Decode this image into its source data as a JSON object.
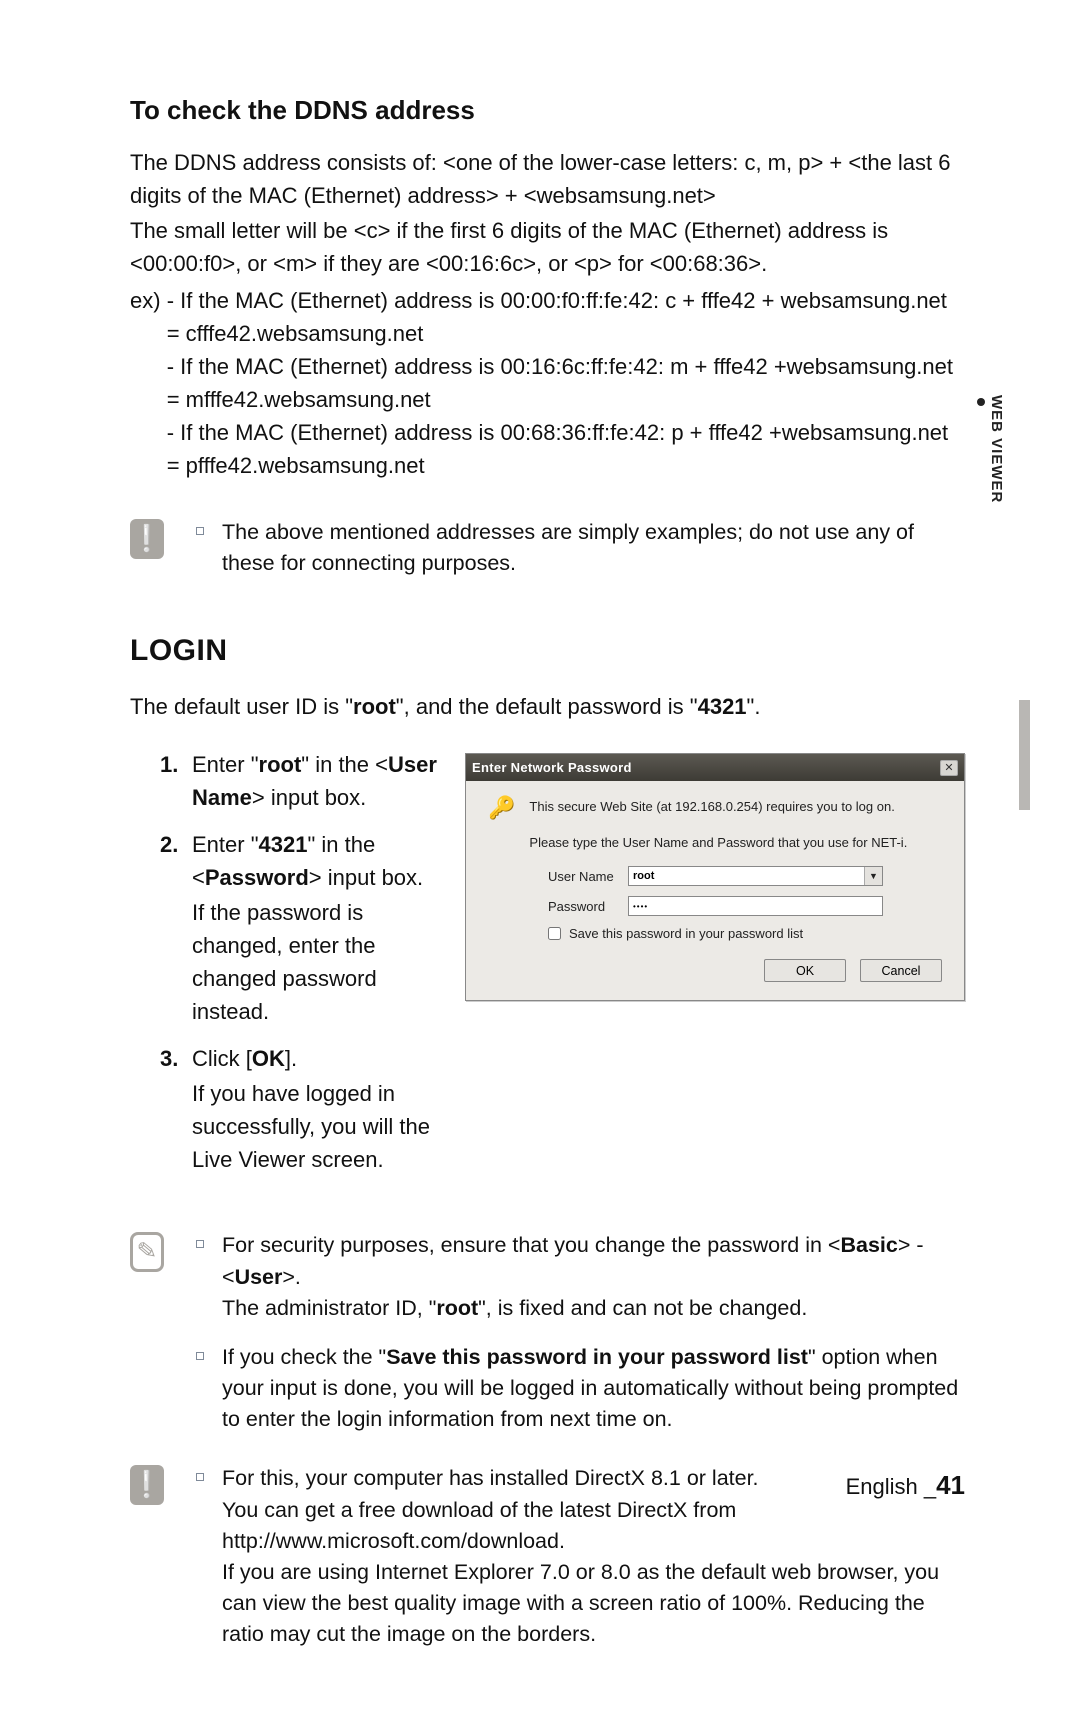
{
  "side_tab": "WEB VIEWER",
  "ddns": {
    "title": "To check the DDNS address",
    "p1": "The DDNS address consists of: <one of the lower-case letters: c, m, p> + <the last 6 digits of the MAC (Ethernet) address> + <websamsung.net>",
    "p2": "The small letter will be <c> if the first 6 digits of the MAC (Ethernet) address is <00:00:f0>, or <m> if they are <00:16:6c>, or <p> for <00:68:36>.",
    "ex_prefix": "ex) ",
    "ex1": "- If the MAC (Ethernet) address is 00:00:f0:ff:fe:42: c + fffe42 + websamsung.net = cfffe42.websamsung.net",
    "ex2": "- If the MAC (Ethernet) address is 00:16:6c:ff:fe:42: m + fffe42 +websamsung.net = mfffe42.websamsung.net",
    "ex3": "- If the MAC (Ethernet) address is 00:68:36:ff:fe:42: p + fffe42 +websamsung.net = pfffe42.websamsung.net",
    "note": "The above mentioned addresses are simply examples; do not use any of these for connecting purposes."
  },
  "login": {
    "title": "LOGIN",
    "intro_pre": "The default user ID is \"",
    "intro_root": "root",
    "intro_mid": "\", and the default password is \"",
    "intro_pass": "4321",
    "intro_post": "\".",
    "steps": {
      "s1_num": "1.",
      "s1_a": "Enter \"",
      "s1_b": "root",
      "s1_c": "\" in the <",
      "s1_d": "User Name",
      "s1_e": "> input box.",
      "s2_num": "2.",
      "s2_a": "Enter \"",
      "s2_b": "4321",
      "s2_c": "\" in the <",
      "s2_d": "Password",
      "s2_e": "> input box.",
      "s2_sub": "If the password is changed, enter the changed password instead.",
      "s3_num": "3.",
      "s3_a": "Click [",
      "s3_b": "OK",
      "s3_c": "].",
      "s3_sub": "If you have logged in successfully, you will the Live Viewer screen."
    },
    "notes1": {
      "n1_a": "For security purposes, ensure that you change the password in <",
      "n1_b": "Basic",
      "n1_c": "> - <",
      "n1_d": "User",
      "n1_e": ">.",
      "n1_line2_a": "The administrator ID, \"",
      "n1_line2_b": "root",
      "n1_line2_c": "\", is fixed and can not be changed.",
      "n2_a": "If you check the \"",
      "n2_b": "Save this password in your password list",
      "n2_c": "\" option when your input is done, you will be logged in automatically without being prompted to enter the login information from next time on."
    },
    "notes2": "For this, your computer has installed DirectX 8.1 or later.\nYou can get a free download of the latest DirectX from http://www.microsoft.com/download.\nIf you are using Internet Explorer 7.0 or 8.0 as the default web browser, you can view the best quality image with a screen ratio of 100%. Reducing the ratio may cut the image on the borders."
  },
  "dialog": {
    "title": "Enter Network Password",
    "close": "✕",
    "msg1": "This secure Web Site (at 192.168.0.254) requires you to log on.",
    "msg2": "Please type the User Name and Password that you use for NET-i.",
    "label_user": "User Name",
    "label_pass": "Password",
    "value_user": "root",
    "value_pass": "••••",
    "arrow": "▼",
    "save_label": "Save this password in your password list",
    "ok": "OK",
    "cancel": "Cancel"
  },
  "footer": {
    "lang": "English _",
    "page": "41"
  }
}
